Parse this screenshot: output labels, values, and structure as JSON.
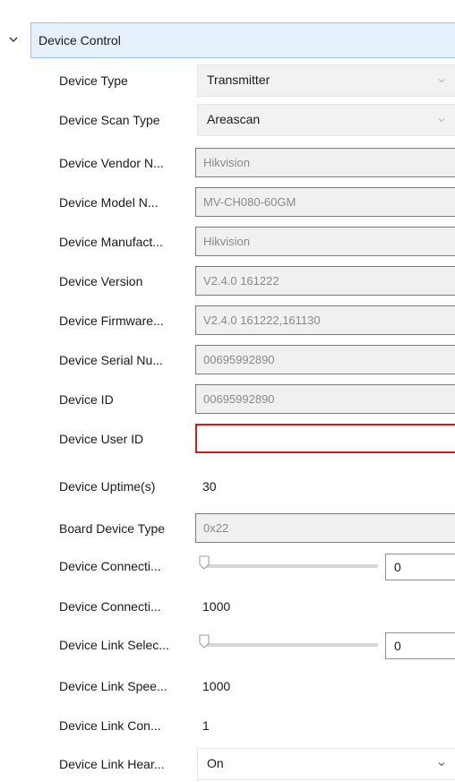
{
  "section": {
    "title": "Device Control",
    "icon": "chevron-down-icon"
  },
  "rows": [
    {
      "label": "Device Type",
      "kind": "select",
      "value": "Transmitter"
    },
    {
      "label": "Device Scan Type",
      "kind": "select",
      "value": "Areascan"
    },
    {
      "label": "Device Vendor N...",
      "kind": "readonly",
      "value": "Hikvision"
    },
    {
      "label": "Device Model N...",
      "kind": "readonly",
      "value": "MV-CH080-60GM"
    },
    {
      "label": "Device Manufact...",
      "kind": "readonly",
      "value": "Hikvision"
    },
    {
      "label": "Device Version",
      "kind": "readonly",
      "value": "V2.4.0 161222"
    },
    {
      "label": "Device Firmware...",
      "kind": "readonly",
      "value": "V2.4.0 161222,161130"
    },
    {
      "label": "Device Serial Nu...",
      "kind": "readonly",
      "value": "00695992890"
    },
    {
      "label": "Device ID",
      "kind": "readonly",
      "value": "00695992890"
    },
    {
      "label": "Device User ID",
      "kind": "input",
      "value": ""
    },
    {
      "label": "Device Uptime(s)",
      "kind": "text",
      "value": "30"
    },
    {
      "label": "Board Device Type",
      "kind": "readonly",
      "value": "0x22"
    },
    {
      "label": "Device Connecti...",
      "kind": "slider",
      "value": "0",
      "level": 0
    },
    {
      "label": "Device Connecti...",
      "kind": "text",
      "value": "1000"
    },
    {
      "label": "Device Link Selec...",
      "kind": "slider",
      "value": "0",
      "level": 0
    },
    {
      "label": "Device Link Spee...",
      "kind": "text",
      "value": "1000"
    },
    {
      "label": "Device Link Con...",
      "kind": "text",
      "value": "1"
    },
    {
      "label": "Device Link Hear...",
      "kind": "select-white",
      "value": "On"
    }
  ],
  "colors": {
    "section_bg": "#e6f0fa",
    "section_border": "#9fc3e6",
    "error_border": "#d71920",
    "readonly_text": "#8a8a8a"
  }
}
